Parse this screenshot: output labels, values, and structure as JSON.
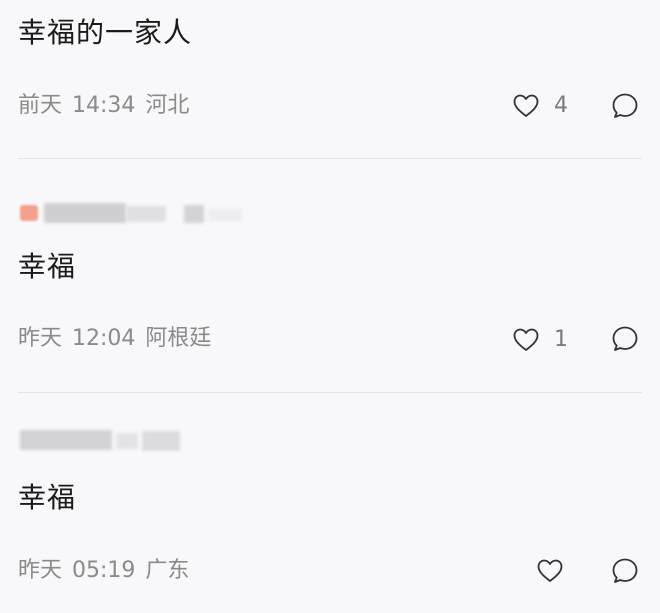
{
  "comments": [
    {
      "text": "幸福的一家人",
      "day": "前天",
      "time": "14:34",
      "location": "河北",
      "likes": "4"
    },
    {
      "text": "幸福",
      "day": "昨天",
      "time": "12:04",
      "location": "阿根廷",
      "likes": "1"
    },
    {
      "text": "幸福",
      "day": "昨天",
      "time": "05:19",
      "location": "广东",
      "likes": ""
    }
  ],
  "icons": {
    "like": "heart-outline-icon",
    "reply": "speech-bubble-outline-icon"
  },
  "colors": {
    "background": "#f8f8fa",
    "text": "#1a1a1a",
    "meta": "#8a8a8a",
    "avatar_accent": "#f4a08c"
  }
}
